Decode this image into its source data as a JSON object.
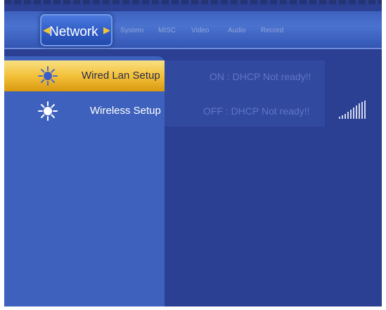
{
  "tabs": {
    "active": "Network",
    "items": [
      "System",
      "MISC",
      "Video",
      "Audio",
      "Record"
    ]
  },
  "menu": {
    "items": [
      {
        "label": "Wired Lan Setup",
        "status": "ON : DHCP Not ready!!",
        "selected": true
      },
      {
        "label": "Wireless Setup",
        "status": "OFF : DHCP Not ready!!",
        "selected": false
      }
    ]
  },
  "icons": {
    "menu_item": "sun-icon",
    "tab_arrows": "arrow-icon",
    "wireless_signal": "signal-strength-icon"
  },
  "colors": {
    "background": "#2b3f93",
    "panel": "#3d61bc",
    "highlight": "#f3c13a",
    "highlight_text": "#2a2a50",
    "status_text": "#5e76c6",
    "tab_accent": "#f3c437"
  }
}
